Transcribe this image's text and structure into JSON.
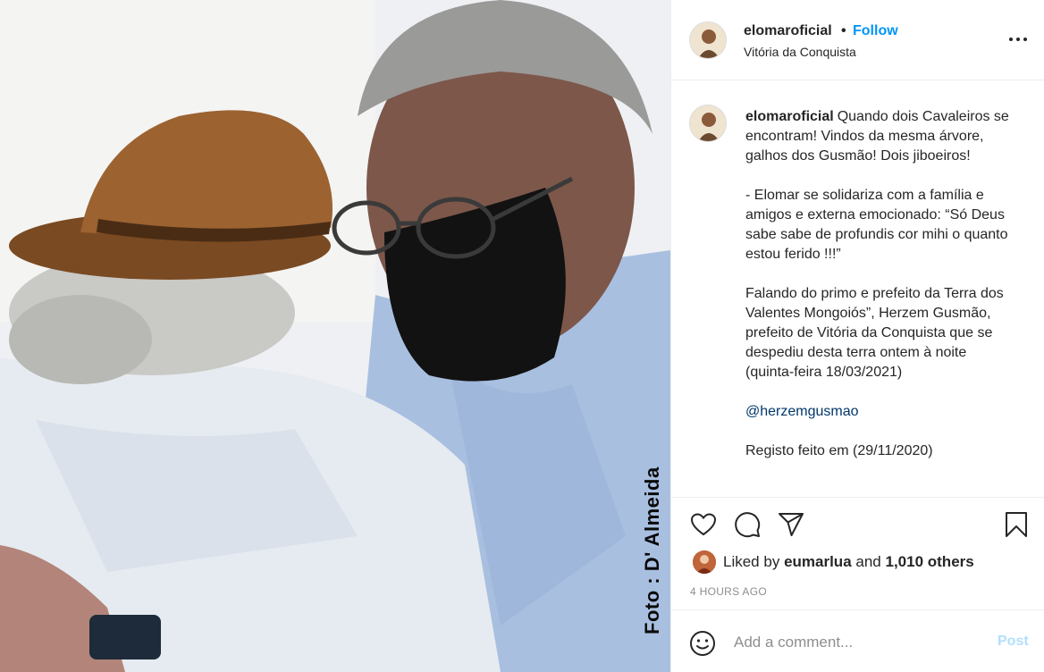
{
  "photo": {
    "credit": "Foto : D' Almeida"
  },
  "header": {
    "username": "elomaroficial",
    "separator": "•",
    "follow_label": "Follow",
    "location": "Vitória da Conquista",
    "more_icon": "more-horizontal-icon"
  },
  "caption": {
    "username": "elomaroficial",
    "paragraphs": [
      "Quando dois Cavaleiros se encontram! Vindos da mesma árvore, galhos dos Gusmão! Dois jiboeiros!",
      "- Elomar se solidariza com a família e amigos e externa emocionado: “Só Deus sabe sabe de profundis cor mihi o quanto estou ferido !!!”",
      "Falando do primo e prefeito da Terra dos Valentes Mongoiós”, Herzem Gusmão, prefeito de Vitória da Conquista que se despediu desta terra ontem à noite (quinta-feira 18/03/2021)"
    ],
    "mention": "@herzemgusmao",
    "last_line": "Registo feito em (29/11/2020)"
  },
  "actions": {
    "like_icon": "heart-icon",
    "comment_icon": "comment-icon",
    "share_icon": "share-icon",
    "save_icon": "bookmark-icon"
  },
  "likes": {
    "prefix": "Liked by",
    "user": "eumarlua",
    "conjunction": "and",
    "others": "1,010 others"
  },
  "timestamp": "4 HOURS AGO",
  "comment": {
    "placeholder": "Add a comment...",
    "post_label": "Post",
    "emoji_icon": "emoji-icon"
  },
  "colors": {
    "link_blue": "#0095f6",
    "post_disabled": "#b2dffc",
    "mention": "#00376b",
    "muted": "#8e8e8e"
  }
}
